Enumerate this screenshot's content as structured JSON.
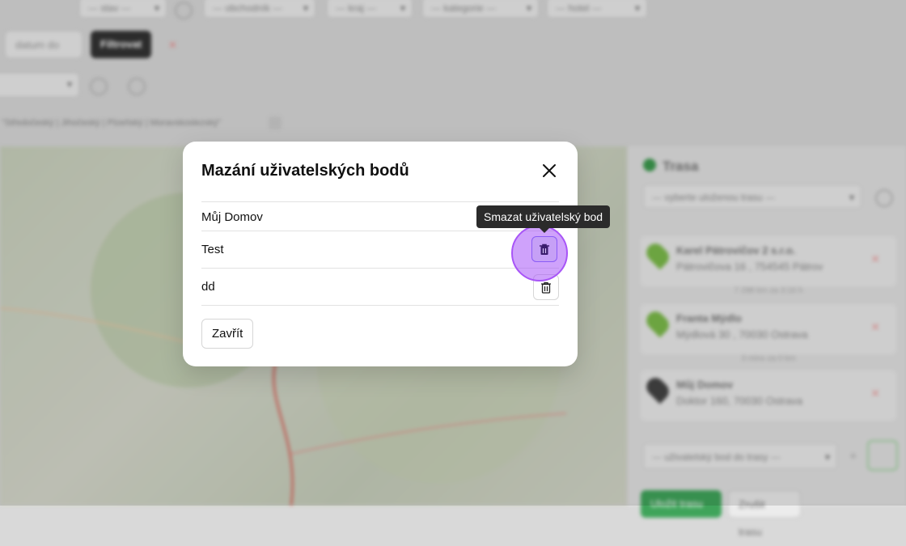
{
  "background": {
    "filters": [
      "--- stav ---",
      "--- obchodník ---",
      "--- kraj ---",
      "--- kategorie ---",
      "--- hotel ---"
    ],
    "filter_button": "Filtrovat",
    "date_placeholder": "datum do",
    "regions_text": "\"Středočeský | Jihočeský | Plzeňský | Moravskoslezský\"",
    "route_title": "Trasa",
    "route_select": "--- vyberte uloženou trasu ---",
    "stops": [
      {
        "name": "Karel Pátrovičov 2 s.r.o.",
        "address": "Pátrovičova 16 , 754545 Pátrov",
        "pin_color": "#7cbb4a"
      },
      {
        "name": "Franta Mýdlo",
        "address": "Mýdlová 30 , 70030 Ostrava",
        "pin_color": "#7cbb4a"
      },
      {
        "name": "Můj Domov",
        "address": "Doktor 160, 70030 Ostrava",
        "pin_color": "#444444"
      }
    ],
    "segments": [
      "7 298 km za 3:16 h",
      "3 mins za 0 km"
    ],
    "user_point_select": "--- uživatelský bod do trasy ---",
    "bottom_buttons": [
      "Uložit trasu",
      "Zrušit trasu"
    ]
  },
  "modal": {
    "title": "Mazání uživatelských bodů",
    "points": [
      {
        "name": "Můj Domov"
      },
      {
        "name": "Test"
      },
      {
        "name": "dd"
      }
    ],
    "close_label": "Zavřít",
    "tooltip": "Smazat uživatelský bod"
  },
  "colors": {
    "accent": "#a855f7",
    "tooltip_bg": "#2b2b2b",
    "border": "#e2e2e2"
  }
}
